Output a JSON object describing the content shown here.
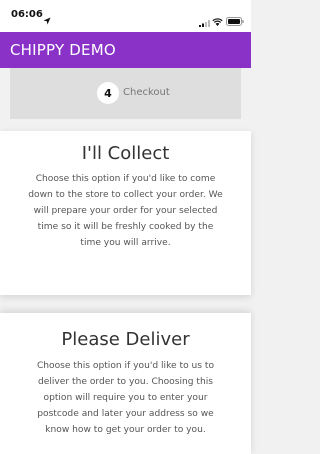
{
  "status_bar": {
    "time": "06:06",
    "icons": [
      "location-arrow-icon",
      "signal-icon",
      "wifi-icon",
      "battery-icon"
    ]
  },
  "app_bar": {
    "title": "CHIPPY DEMO",
    "background": "#8a32c8"
  },
  "step": {
    "number": "4",
    "label": "Checkout"
  },
  "options": [
    {
      "title": "I'll Collect",
      "description": "Choose this option if you'd like to come down to the store to collect your order. We will prepare your order for your selected time so it will be freshly cooked by the time you will arrive."
    },
    {
      "title": "Please Deliver",
      "description": "Choose this option if you'd like to us to deliver the order to you. Choosing this option will require you to enter your postcode and later your address so we know how to get your order to you."
    }
  ]
}
